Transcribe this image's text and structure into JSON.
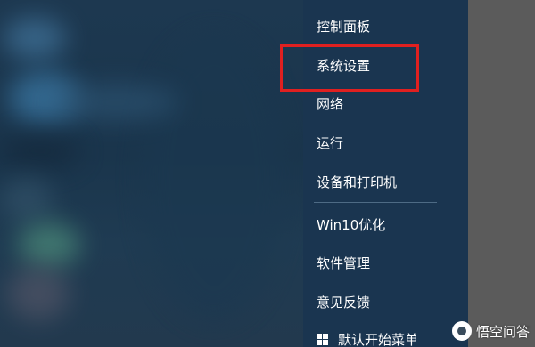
{
  "menu": {
    "items": [
      {
        "label": "控制面板"
      },
      {
        "label": "系统设置"
      },
      {
        "label": "网络"
      },
      {
        "label": "运行"
      },
      {
        "label": "设备和打印机"
      },
      {
        "label": "Win10优化"
      },
      {
        "label": "软件管理"
      },
      {
        "label": "意见反馈"
      },
      {
        "label": "默认开始菜单",
        "icon": "windows-logo-icon"
      }
    ],
    "highlighted_item": "系统设置"
  },
  "watermark": {
    "text": "悟空问答"
  },
  "colors": {
    "menu_background": "#1a3550",
    "menu_text": "#ffffff",
    "highlight_border": "#e02020",
    "right_panel": "#5b5b5b"
  }
}
